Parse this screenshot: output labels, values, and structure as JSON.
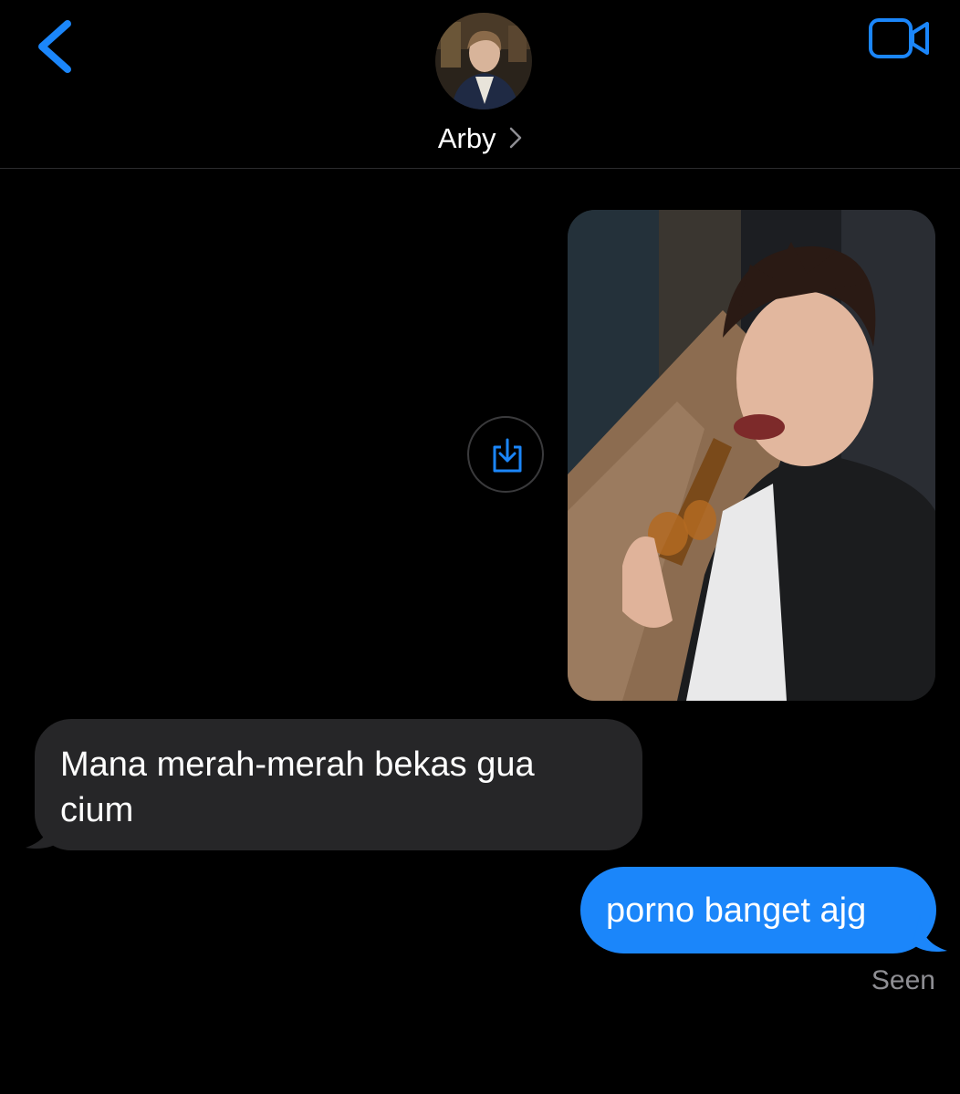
{
  "header": {
    "contact_name": "Arby",
    "back_icon": "chevron-left-icon",
    "video_icon": "video-camera-icon",
    "accent_color": "#1b86fa"
  },
  "messages": [
    {
      "direction": "outgoing",
      "type": "photo"
    },
    {
      "direction": "incoming",
      "type": "text",
      "text": "Mana merah-merah bekas gua cium"
    },
    {
      "direction": "outgoing",
      "type": "text",
      "text": "porno banget ajg"
    }
  ],
  "status": {
    "seen_label": "Seen"
  },
  "colors": {
    "background": "#000000",
    "incoming_bubble": "#262628",
    "outgoing_bubble": "#1b86fa",
    "secondary_text": "#8e8e93"
  }
}
